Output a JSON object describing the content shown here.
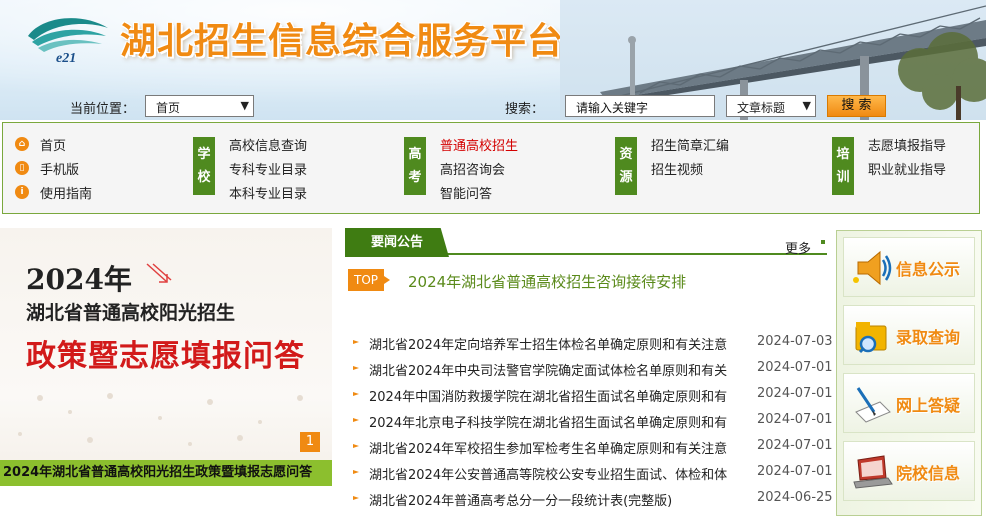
{
  "header": {
    "logo_text": "e21",
    "site_title": "湖北招生信息综合服务平台",
    "location_label": "当前位置：",
    "location_value": "首页",
    "search_label": "搜索：",
    "search_placeholder": "请输入关键字",
    "search_type_value": "文章标题",
    "search_button": "搜 索"
  },
  "nav": {
    "left_links": [
      {
        "label": "首页",
        "icon": "home-icon"
      },
      {
        "label": "手机版",
        "icon": "mobile-icon"
      },
      {
        "label": "使用指南",
        "icon": "info-icon"
      }
    ],
    "groups": [
      {
        "badge": [
          "学",
          "校"
        ],
        "links": [
          "高校信息查询",
          "专科专业目录",
          "本科专业目录"
        ]
      },
      {
        "badge": [
          "高",
          "考"
        ],
        "links": [
          "普通高校招生",
          "高招咨询会",
          "智能问答"
        ]
      },
      {
        "badge": [
          "资",
          "源"
        ],
        "links": [
          "招生简章汇编",
          "招生视频"
        ]
      },
      {
        "badge": [
          "培",
          "训"
        ],
        "links": [
          "志愿填报指导",
          "职业就业指导"
        ]
      }
    ]
  },
  "banner": {
    "year": "2024年",
    "subtitle": "湖北省普通高校阳光招生",
    "main_title": "政策暨志愿填报问答",
    "page_indicator": "1",
    "caption": "2024年湖北省普通高校阳光招生政策暨填报志愿问答"
  },
  "news": {
    "tab_label": "要闻公告",
    "more_label": "更多",
    "top_badge": "TOP",
    "top_headline": "2024年湖北省普通高校招生咨询接待安排",
    "items": [
      {
        "title": "湖北省2024年定向培养军士招生体检名单确定原则和有关注意",
        "date": "2024-07-03"
      },
      {
        "title": "湖北省2024年中央司法警官学院确定面试体检名单原则和有关",
        "date": "2024-07-01"
      },
      {
        "title": "2024年中国消防救援学院在湖北省招生面试名单确定原则和有",
        "date": "2024-07-01"
      },
      {
        "title": "2024年北京电子科技学院在湖北省招生面试名单确定原则和有",
        "date": "2024-07-01"
      },
      {
        "title": "湖北省2024年军校招生参加军检考生名单确定原则和有关注意",
        "date": "2024-07-01"
      },
      {
        "title": "湖北省2024年公安普通高等院校公安专业招生面试、体检和体",
        "date": "2024-07-01"
      },
      {
        "title": "湖北省2024年普通高考总分一分一段统计表(完整版)",
        "date": "2024-06-25"
      }
    ]
  },
  "services": [
    {
      "label": "信息公示",
      "icon": "megaphone-icon"
    },
    {
      "label": "录取查询",
      "icon": "folder-search-icon"
    },
    {
      "label": "网上答疑",
      "icon": "document-pen-icon"
    },
    {
      "label": "院校信息",
      "icon": "laptop-icon"
    }
  ],
  "colors": {
    "brand_orange": "#f08a12",
    "brand_green": "#4f8a1f",
    "active_link": "#d40000"
  }
}
